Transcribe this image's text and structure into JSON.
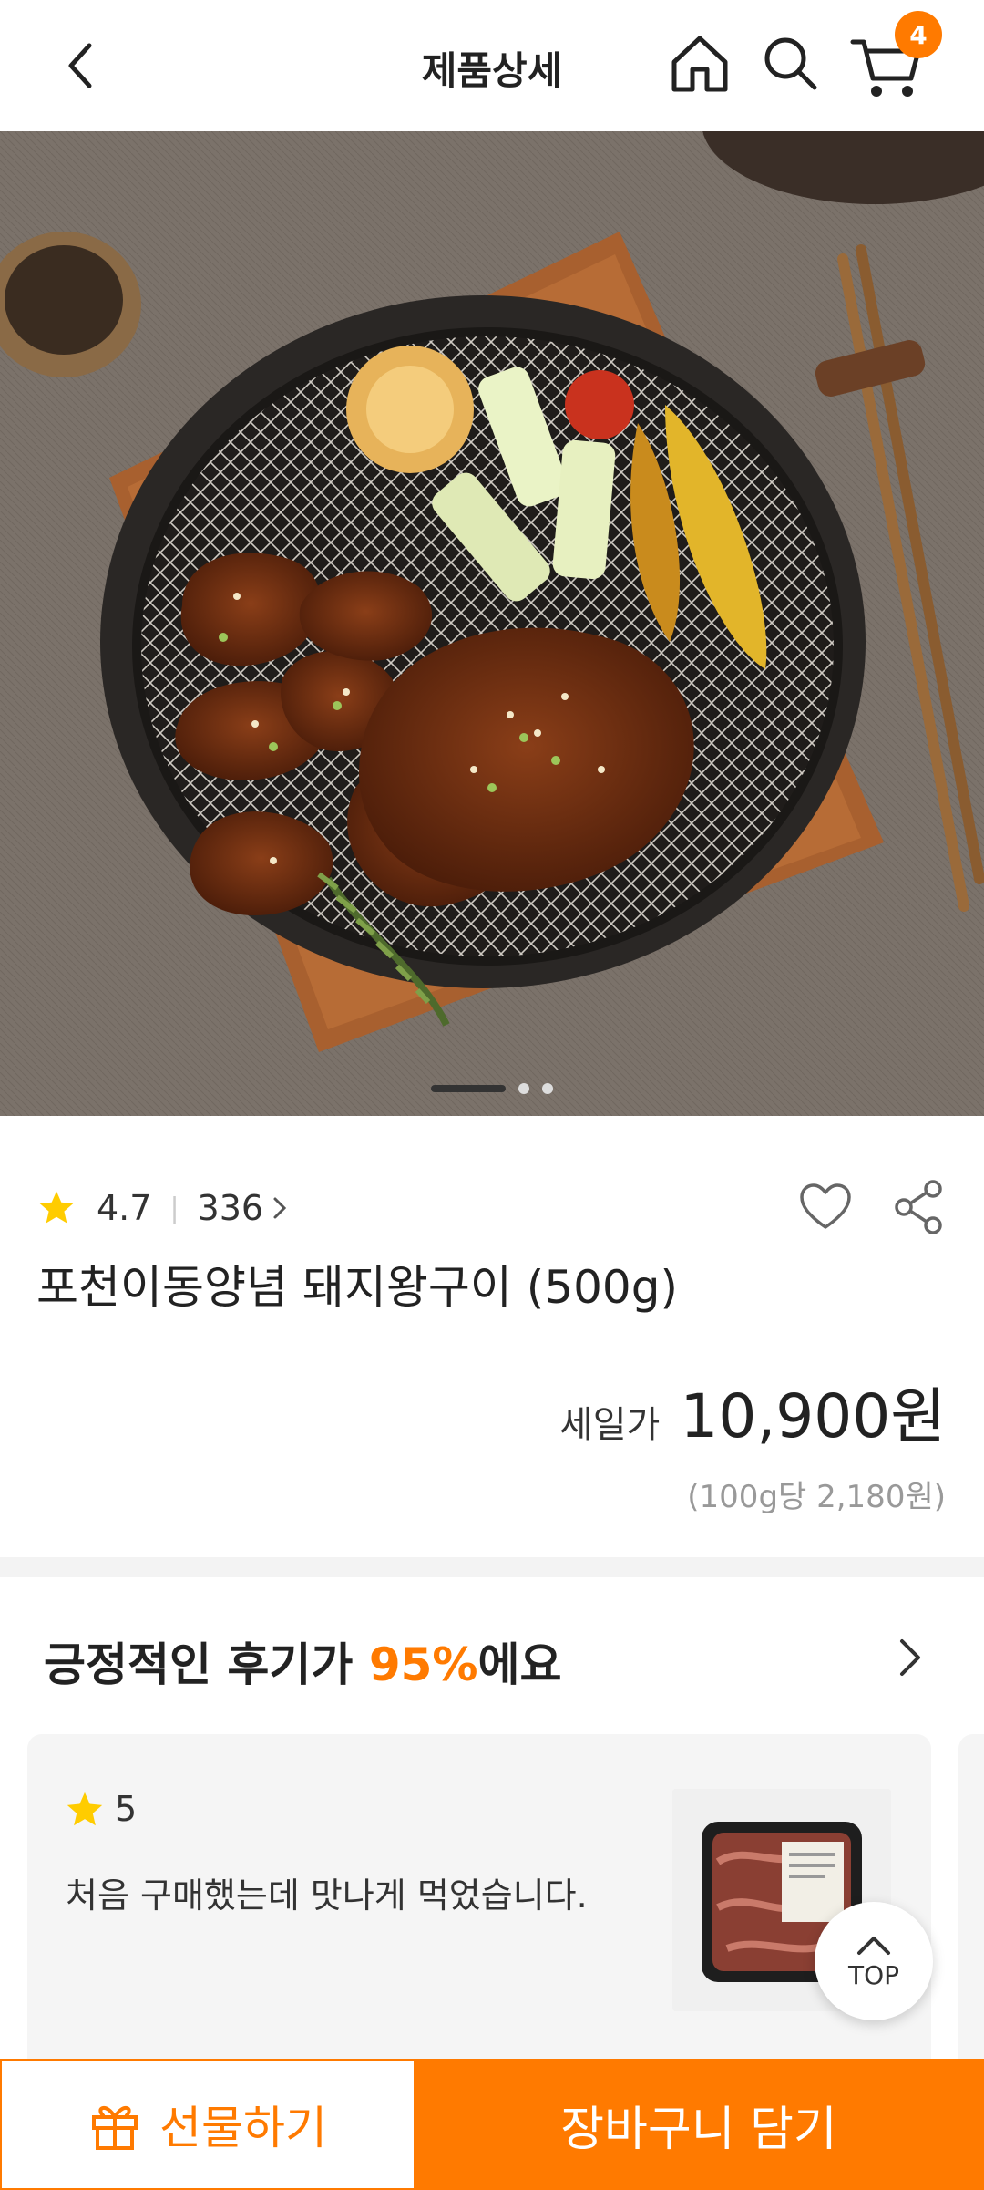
{
  "header": {
    "title": "제품상세",
    "cart_count": "4"
  },
  "colors": {
    "accent": "#ff7a00",
    "star": "#ffcc00"
  },
  "gallery": {
    "active_index": 1,
    "total": 3
  },
  "product": {
    "rating": "4.7",
    "review_count": "336",
    "name": "포천이동양념 돼지왕구이 (500g)",
    "sale_label": "세일가",
    "price": "10,900원",
    "unit_price": "(100g당 2,180원)"
  },
  "reviews": {
    "title_prefix": "긍정적인 후기가 ",
    "title_percent": "95%",
    "title_suffix": "에요",
    "items": [
      {
        "score": "5",
        "text": "처음 구매했는데 맛나게 먹었습니다."
      }
    ]
  },
  "top_button": {
    "label": "TOP"
  },
  "bottom_bar": {
    "gift_label": "선물하기",
    "cart_label": "장바구니 담기"
  }
}
